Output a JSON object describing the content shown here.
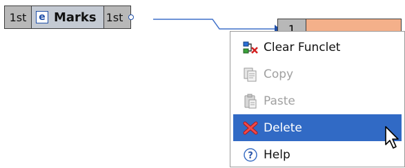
{
  "source_component": {
    "left_port": "1st",
    "type_badge": "e",
    "name": "Marks",
    "right_port": "1st"
  },
  "target_component": {
    "left_port": "1"
  },
  "context_menu": {
    "items": [
      {
        "label": "Clear Funclet",
        "icon": "clear-funclet-icon",
        "enabled": true
      },
      {
        "label": "Copy",
        "icon": "copy-icon",
        "enabled": false
      },
      {
        "label": "Paste",
        "icon": "paste-icon",
        "enabled": false
      },
      {
        "label": "Delete",
        "icon": "delete-icon",
        "enabled": true,
        "selected": true
      },
      {
        "label": "Help",
        "icon": "help-icon",
        "enabled": true
      }
    ]
  },
  "colors": {
    "selection": "#316ac5",
    "wire": "#1f4fa8",
    "target_body": "#f4b08a"
  }
}
